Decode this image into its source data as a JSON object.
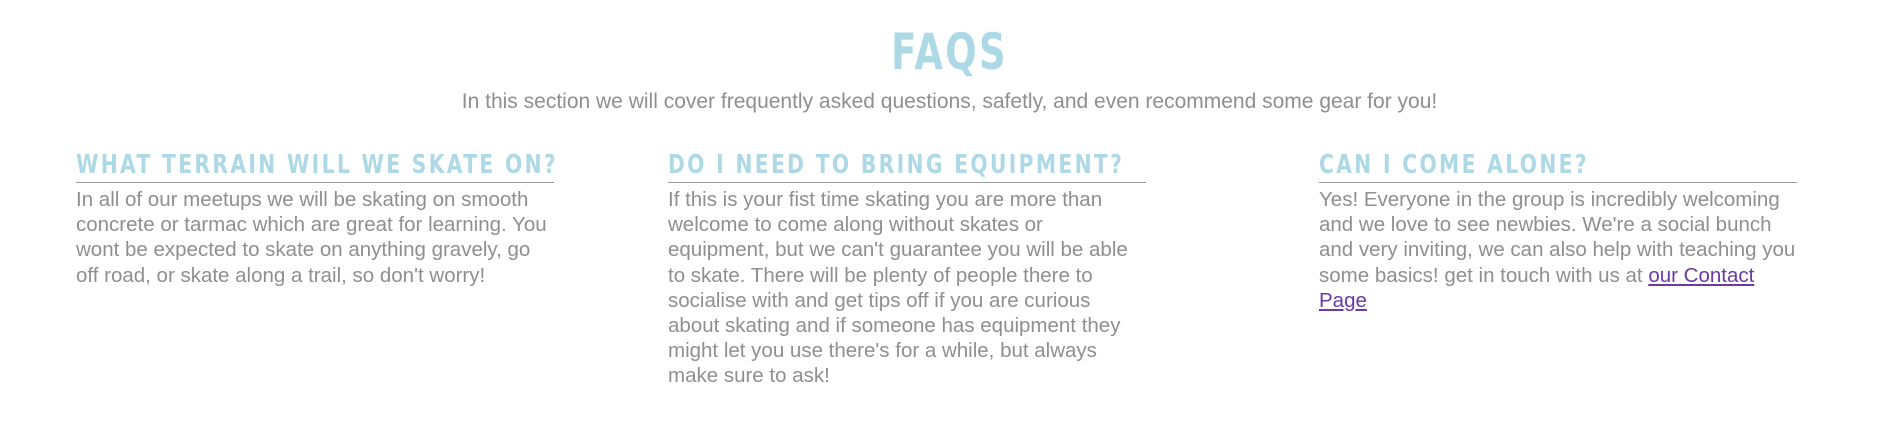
{
  "faqs_section": {
    "title": "FAQS",
    "subtitle": "In this section we will cover frequently asked questions, safetly, and even recommend some gear for you!",
    "items": [
      {
        "question": "WHAT TERRAIN WILL WE SKATE ON?",
        "answer": "In all of our meetups we will be skating on smooth concrete or tarmac which are great for learning. You wont be expected to skate on anything gravely, go off road, or skate along a trail, so don't worry!"
      },
      {
        "question": "DO I NEED TO BRING EQUIPMENT?",
        "answer": "If this is your fist time skating you are more than welcome to come along without skates or equipment, but we can't guarantee you will be able to skate. There will be plenty of people there to socialise with and get tips off if you are curious about skating and if someone has equipment they might let you use there's for a while, but always make sure to ask!"
      },
      {
        "question": "CAN I COME ALONE?",
        "answer": "Yes! Everyone in the group is incredibly welcoming and we love to see newbies. We're a social bunch and very inviting, we can also help with teaching you some basics! get in touch with us at",
        "link_text": "our Contact Page"
      }
    ]
  },
  "colors": {
    "heading": "#add8e6",
    "body_text": "#8f8f8f",
    "divider": "#9a9a9a",
    "link": "#6b3aa6",
    "background": "#ffffff"
  }
}
